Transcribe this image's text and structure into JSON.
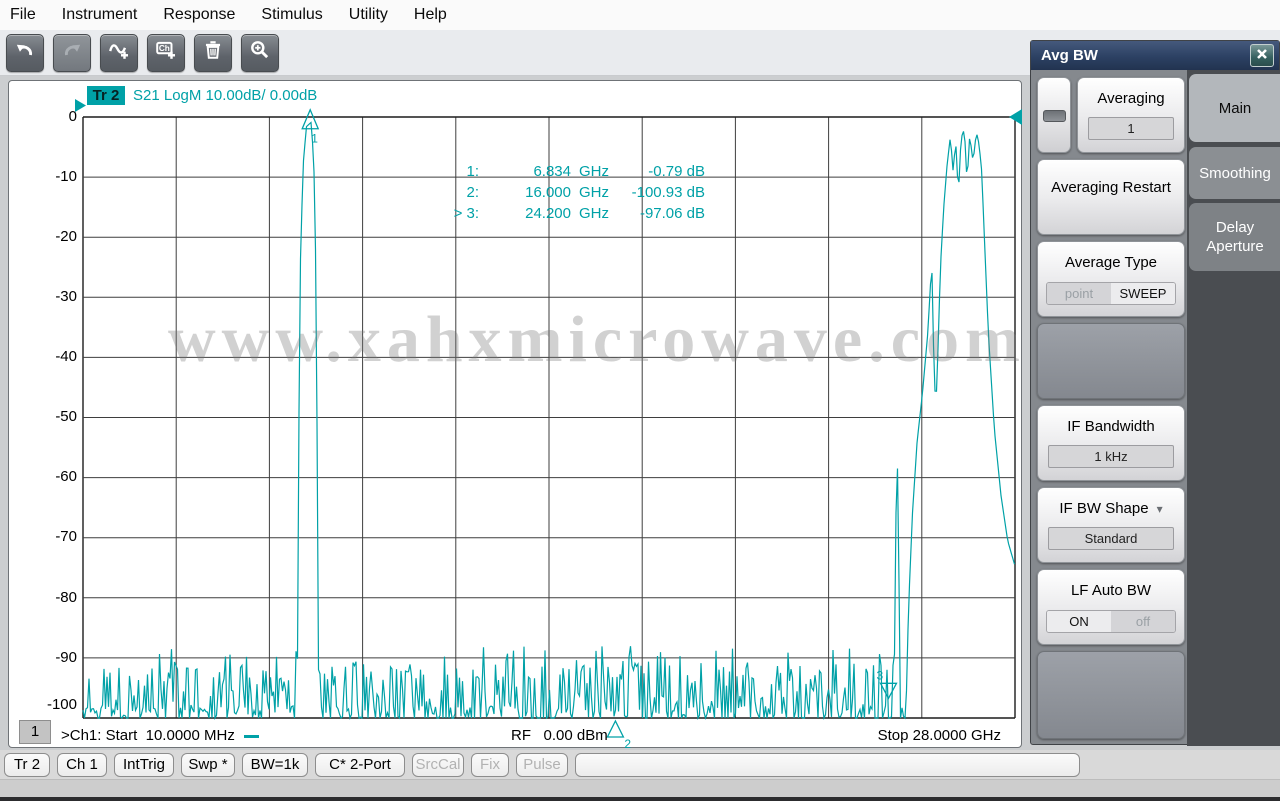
{
  "menu": {
    "items": [
      "File",
      "Instrument",
      "Response",
      "Stimulus",
      "Utility",
      "Help"
    ]
  },
  "toolbar": {
    "icons": [
      "undo",
      "redo",
      "add-trace",
      "add-channel",
      "delete",
      "zoom-in"
    ],
    "disabled": [
      "redo"
    ]
  },
  "plot": {
    "badge": "Tr 2",
    "title": "S21 LogM 10.00dB/ 0.00dB",
    "y_labels": [
      "0",
      "-10",
      "-20",
      "-30",
      "-40",
      "-50",
      "-60",
      "-70",
      "-80",
      "-90",
      "-100"
    ],
    "readout": [
      {
        "label": "1:",
        "freq": "6.834",
        "unit": "GHz",
        "value": "-0.79 dB"
      },
      {
        "label": "2:",
        "freq": "16.000",
        "unit": "GHz",
        "value": "-100.93 dB"
      },
      {
        "label": "> 3:",
        "freq": "24.200",
        "unit": "GHz",
        "value": "-97.06 dB"
      }
    ],
    "channel_box": "1",
    "start_text": ">Ch1: Start  10.0000 MHz",
    "rf_text": "RF   0.00 dBm",
    "stop_text": "Stop 28.0000 GHz"
  },
  "watermark": {
    "text": "www.xahxmicrowave.com"
  },
  "panel": {
    "title": "Avg BW",
    "tabs": [
      {
        "label": "Main",
        "active": true
      },
      {
        "label": "Smoothing",
        "active": false
      },
      {
        "label": "Delay Aperture",
        "active": false
      }
    ],
    "controls": {
      "averaging": {
        "label": "Averaging",
        "value": "1"
      },
      "averaging_restart": "Averaging Restart",
      "average_type": {
        "label": "Average Type",
        "options": [
          "point",
          "SWEEP"
        ],
        "selected": "SWEEP"
      },
      "if_bandwidth": {
        "label": "IF Bandwidth",
        "value": "1 kHz"
      },
      "if_bw_shape": {
        "label": "IF BW Shape",
        "value": "Standard"
      },
      "lf_auto_bw": {
        "label": "LF Auto BW",
        "options": [
          "ON",
          "off"
        ],
        "selected": "ON"
      }
    }
  },
  "statusbar": {
    "buttons": [
      {
        "label": "Tr 2",
        "enabled": true
      },
      {
        "label": "Ch 1",
        "enabled": true
      },
      {
        "label": "IntTrig",
        "enabled": true
      },
      {
        "label": "Swp *",
        "enabled": true
      },
      {
        "label": "BW=1k",
        "enabled": true
      },
      {
        "label": "C* 2-Port",
        "enabled": true
      },
      {
        "label": "SrcCal",
        "enabled": false
      },
      {
        "label": "Fix",
        "enabled": false
      },
      {
        "label": "Pulse",
        "enabled": false
      }
    ]
  },
  "colors": {
    "trace": "#00A1A7",
    "panel_header": "#2C4163",
    "grid_line": "#3e3e3e"
  },
  "chart_data": {
    "type": "line",
    "title": "S21 LogM 10.00dB/ 0.00dB",
    "x_unit": "GHz",
    "x_range": [
      0.01,
      28.0
    ],
    "y_unit": "dB",
    "y_range": [
      -100,
      0
    ],
    "y_ticks": [
      0,
      -10,
      -20,
      -30,
      -40,
      -50,
      -60,
      -70,
      -80,
      -90,
      -100
    ],
    "x_divisions": 10,
    "scale_per_div_db": 10.0,
    "reference_level_db": 0.0,
    "noise_base_db": -101,
    "trace_color": "#00A1A7",
    "envelope_points_ghz_db": [
      [
        0.01,
        -101
      ],
      [
        0.018,
        -86
      ],
      [
        0.03,
        -101
      ],
      [
        6.44,
        -101
      ],
      [
        6.52,
        -28
      ],
      [
        6.62,
        -8
      ],
      [
        6.72,
        -1.6
      ],
      [
        6.86,
        -0.9
      ],
      [
        6.94,
        -7
      ],
      [
        7.02,
        -30
      ],
      [
        7.08,
        -101
      ],
      [
        24.36,
        -101
      ],
      [
        24.42,
        -68
      ],
      [
        24.46,
        -54
      ],
      [
        24.51,
        -74
      ],
      [
        24.56,
        -101
      ],
      [
        24.72,
        -101
      ],
      [
        24.8,
        -82
      ],
      [
        24.92,
        -66
      ],
      [
        25.06,
        -54
      ],
      [
        25.22,
        -46
      ],
      [
        25.38,
        -36
      ],
      [
        25.5,
        -24
      ],
      [
        25.56,
        -40
      ],
      [
        25.62,
        -49
      ],
      [
        25.68,
        -40
      ],
      [
        25.76,
        -25
      ],
      [
        25.86,
        -15
      ],
      [
        25.96,
        -8
      ],
      [
        26.06,
        -3.2
      ],
      [
        26.14,
        -9
      ],
      [
        26.22,
        -4
      ],
      [
        26.3,
        -13
      ],
      [
        26.38,
        -3.5
      ],
      [
        26.48,
        -2
      ],
      [
        26.56,
        -11
      ],
      [
        26.64,
        -3
      ],
      [
        26.74,
        -7.5
      ],
      [
        26.84,
        -2.5
      ],
      [
        26.92,
        -4.5
      ],
      [
        27.0,
        -9
      ],
      [
        27.08,
        -20
      ],
      [
        27.2,
        -36
      ],
      [
        27.38,
        -52
      ],
      [
        27.58,
        -63
      ],
      [
        27.78,
        -70.5
      ],
      [
        27.99,
        -74.5
      ]
    ],
    "markers": [
      {
        "id": "1",
        "freq_ghz": 6.834,
        "value_db": -0.79,
        "glyph": "up",
        "active": false
      },
      {
        "id": "2",
        "freq_ghz": 16.0,
        "value_db": -100.93,
        "glyph": "below",
        "active": false
      },
      {
        "id": "3",
        "freq_ghz": 24.2,
        "value_db": -97.06,
        "glyph": "down",
        "active": true
      }
    ],
    "start_label": "Start 10.0000 MHz",
    "stop_label": "Stop 28.0000 GHz",
    "power_label": "RF 0.00 dBm"
  }
}
